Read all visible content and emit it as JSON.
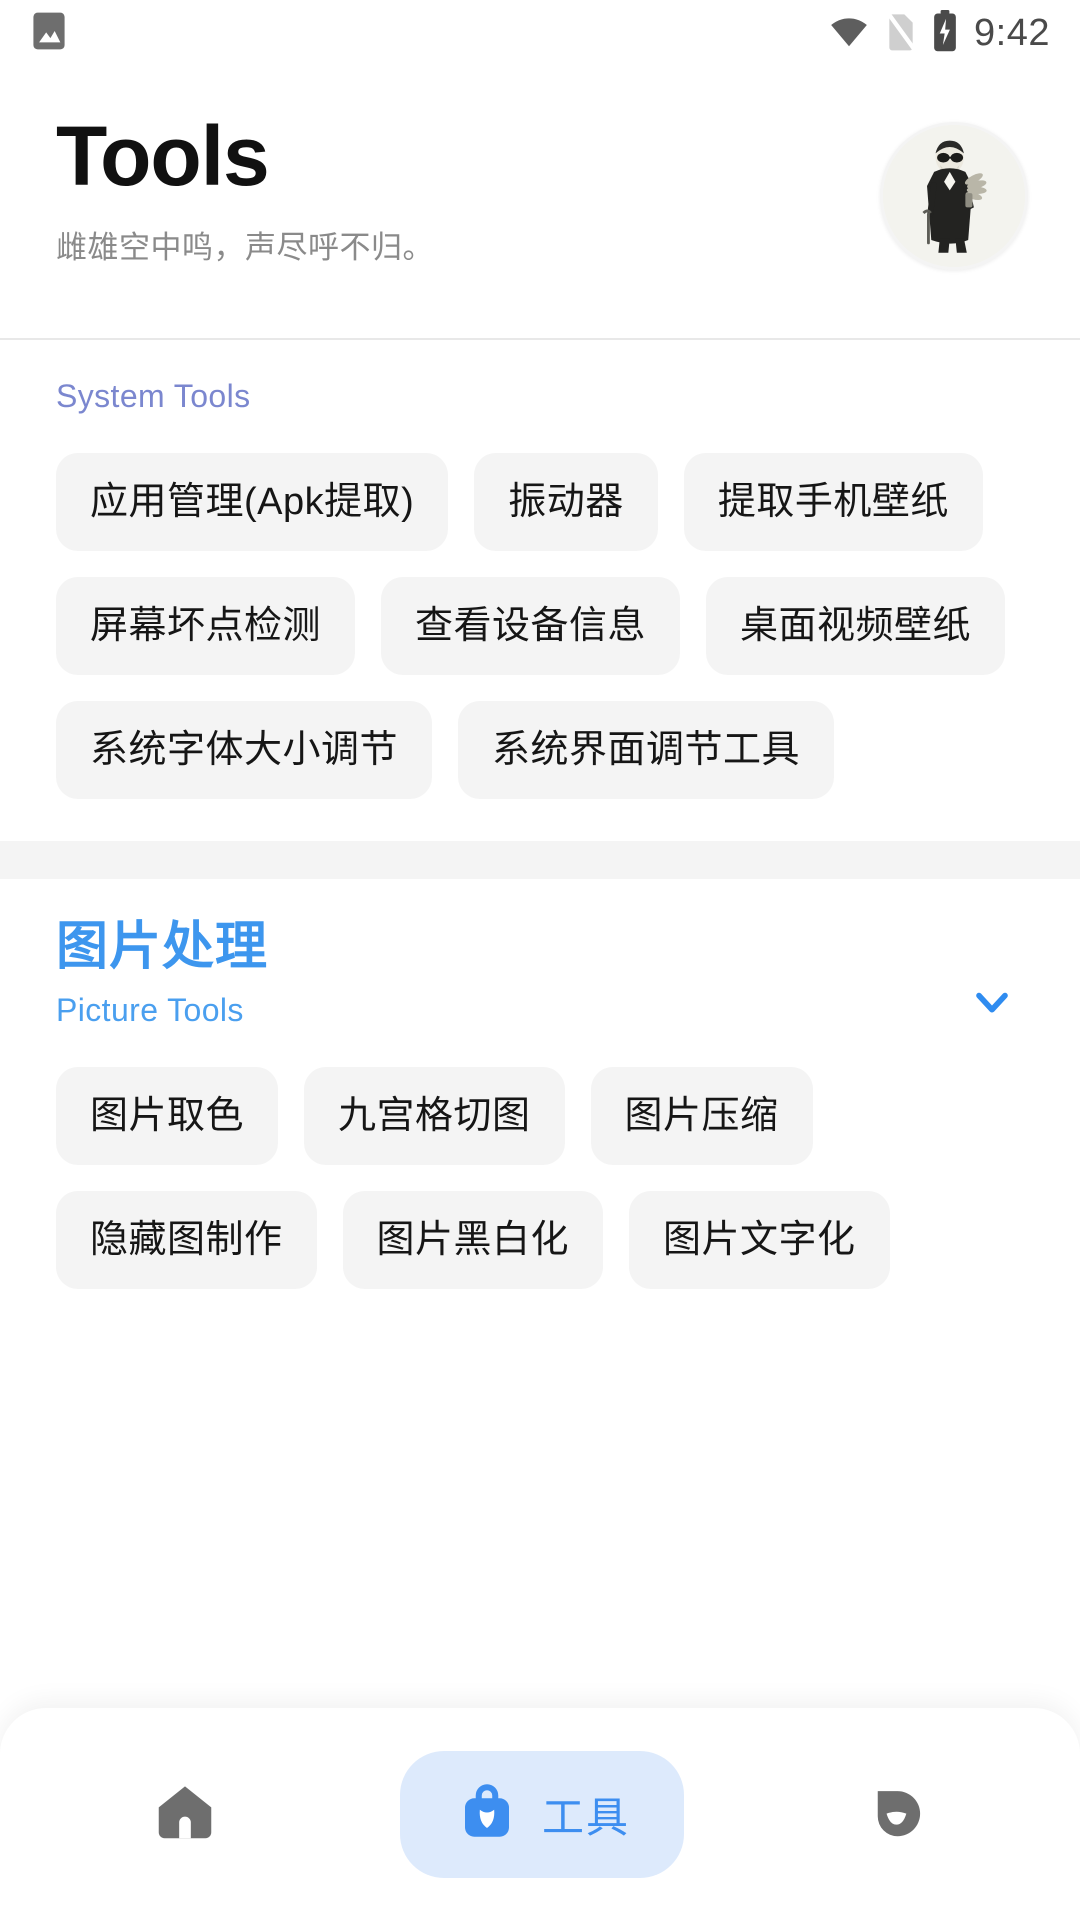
{
  "status_bar": {
    "time": "9:42",
    "left_icons": [
      "image-notification-icon"
    ],
    "right_icons": [
      "wifi-icon",
      "no-sim-icon",
      "battery-charging-icon"
    ]
  },
  "header": {
    "title": "Tools",
    "subtitle": "雌雄空中鸣，声尽呼不归。",
    "avatar_name": "user-avatar",
    "avatar_bg": "#f3f3ec"
  },
  "colors": {
    "accent_blue": "#3d96ee",
    "muted_purple": "#7b87cf",
    "chip_bg": "#f4f4f4",
    "nav_active_bg": "#ddeafc",
    "nav_inactive": "#6e6e6e"
  },
  "sections": [
    {
      "title_cn": "",
      "title_en": "System Tools",
      "en_color": "muted",
      "chevron": "chevron-down-icon-clipped",
      "chips": [
        "应用管理(Apk提取)",
        "振动器",
        "提取手机壁纸",
        "屏幕坏点检测",
        "查看设备信息",
        "桌面视频壁纸",
        "系统字体大小调节",
        "系统界面调节工具"
      ]
    },
    {
      "title_cn": "图片处理",
      "title_en": "Picture Tools",
      "en_color": "blue",
      "chevron": "chevron-down-icon",
      "chips": [
        "图片取色",
        "九宫格切图",
        "图片压缩",
        "隐藏图制作",
        "图片黑白化",
        "图片文字化"
      ]
    }
  ],
  "bottom_nav": {
    "items": [
      {
        "icon": "home-icon",
        "label": "",
        "active": false
      },
      {
        "icon": "toolbox-icon",
        "label": "工具",
        "active": true
      },
      {
        "icon": "mask-icon",
        "label": "",
        "active": false
      }
    ]
  }
}
